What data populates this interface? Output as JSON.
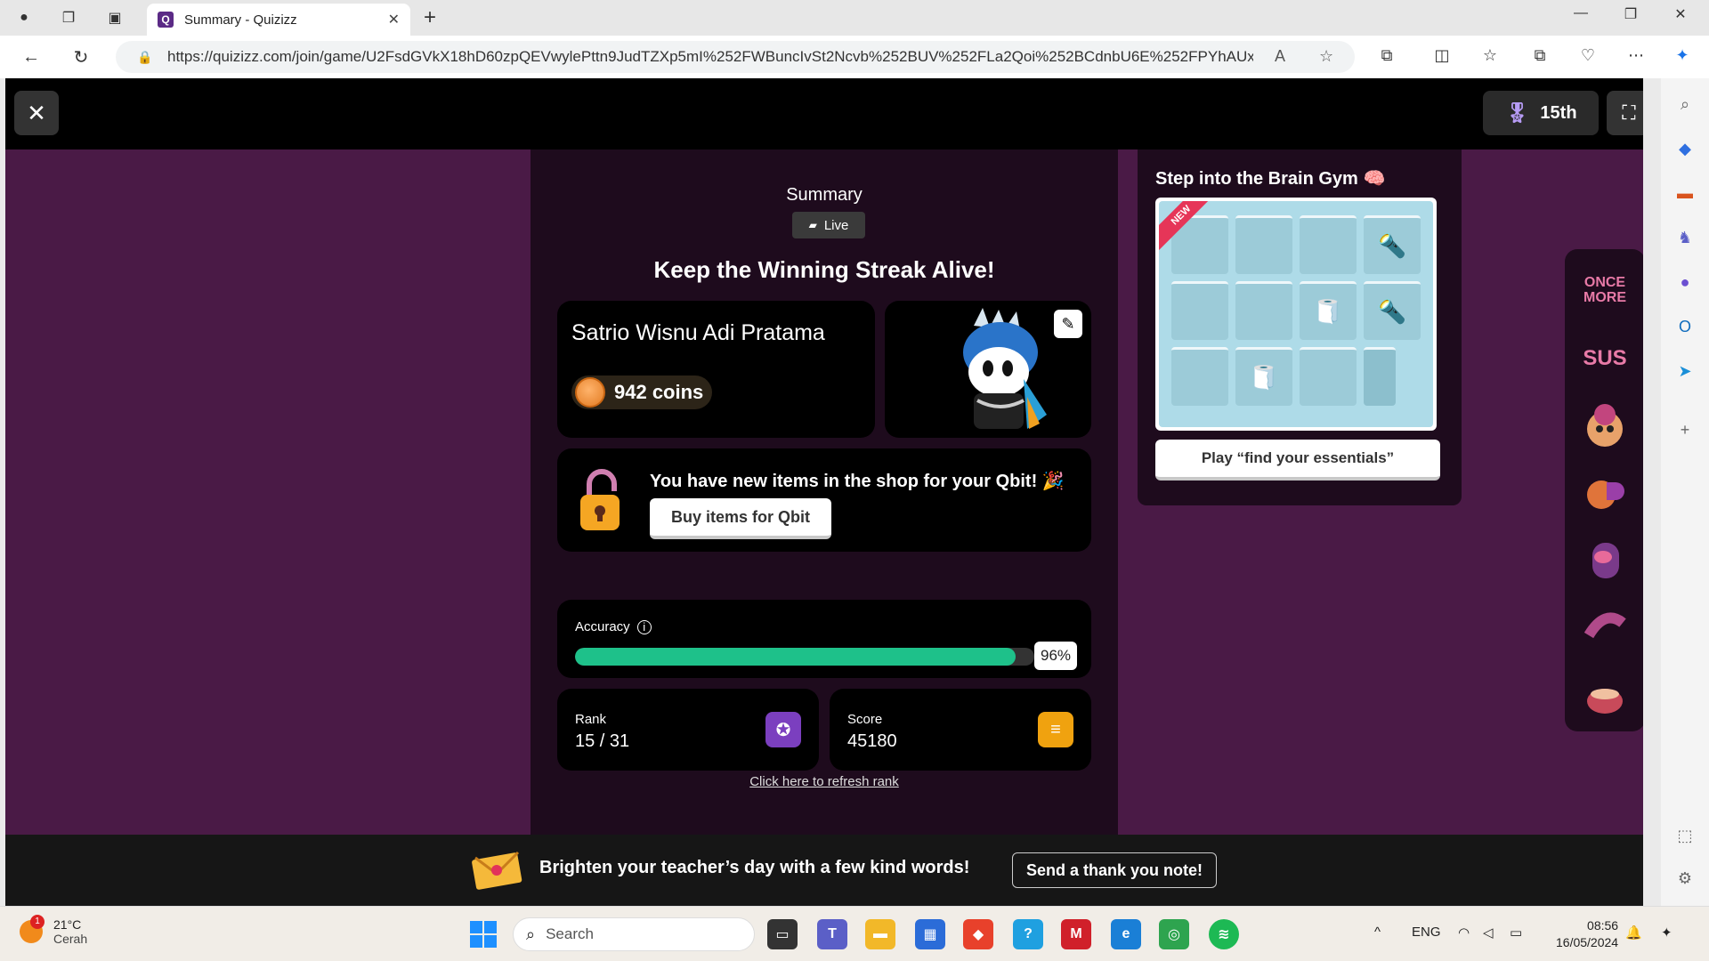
{
  "browser": {
    "tab_title": "Summary - Quizizz",
    "tab_favicon": "Q",
    "url": "https://quizizz.com/join/game/U2FsdGVkX18hD60zpQEVwylePttn9JudTZXp5mI%252FWBuncIvSt2Ncvb%252BUV%252FLa2Qoi%252BCdnbU6E%252FPYhAUx..."
  },
  "topbar": {
    "close_label": "✕",
    "rank_label": "15th"
  },
  "summary": {
    "heading": "Summary",
    "mode_label": "Live",
    "streak_heading": "Keep the Winning Streak Alive!",
    "player_name": "Satrio Wisnu Adi Pratama",
    "coins": "942 coins",
    "shop_message": "You have new items in the shop for your Qbit! 🎉",
    "shop_button": "Buy items for Qbit",
    "accuracy_label": "Accuracy",
    "accuracy_percent": "96%",
    "accuracy_value": 0.96,
    "rank_label": "Rank",
    "rank_value": "15 / 31",
    "score_label": "Score",
    "score_value": "45180",
    "refresh_link": "Click here to refresh rank"
  },
  "brain_gym": {
    "title": "Step into the Brain Gym",
    "new_tag": "NEW",
    "play_button": "Play “find your essentials”"
  },
  "rail": {
    "items": [
      "ONCE MORE",
      "SUS",
      "",
      "",
      "",
      "",
      ""
    ]
  },
  "banner": {
    "text": "Brighten your teacher’s day with a few kind words!",
    "button": "Send a thank you note!"
  },
  "taskbar": {
    "weather_temp": "21°C",
    "weather_desc": "Cerah",
    "weather_badge": "1",
    "search_placeholder": "Search",
    "lang": "ENG",
    "time": "08:56",
    "date": "16/05/2024"
  },
  "colors": {
    "accent_purple": "#4a1a46",
    "accuracy_green": "#1ec18a",
    "rank_icon": "#7b3fbf",
    "score_icon": "#f0a20f"
  }
}
